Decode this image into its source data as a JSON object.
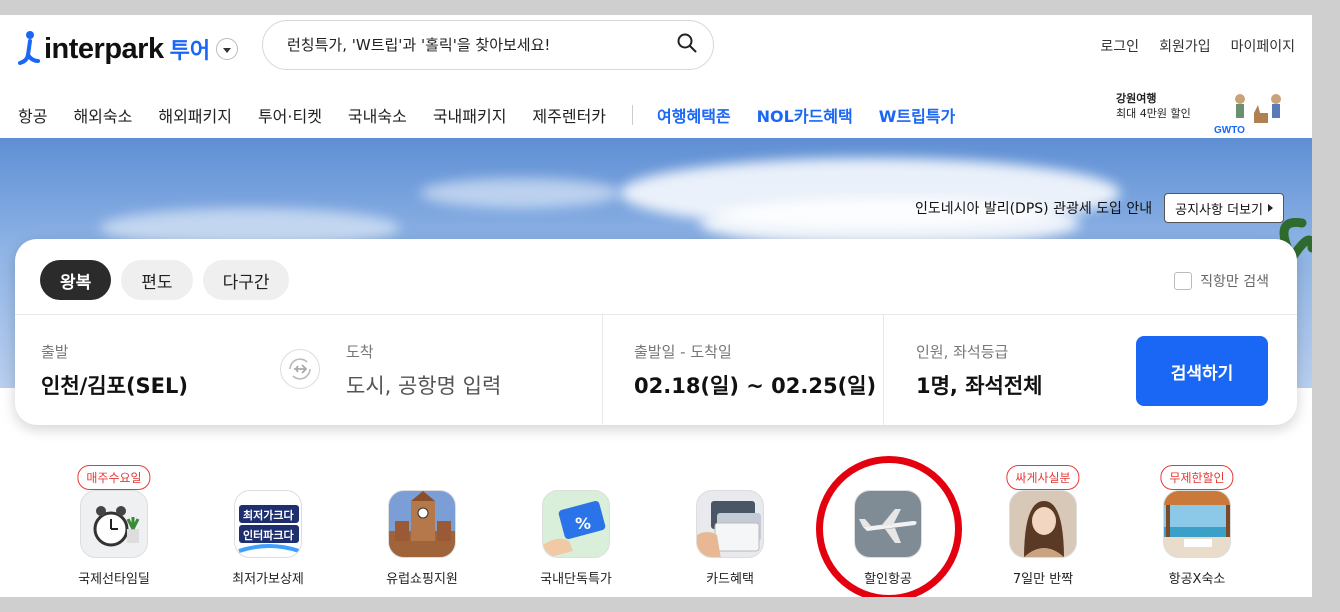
{
  "header": {
    "logo_text": "interpark",
    "logo_sub": "투어",
    "search_placeholder": "런칭특가, 'W트립'과 '홀릭'을 찾아보세요!",
    "links": [
      "로그인",
      "회원가입",
      "마이페이지"
    ]
  },
  "gnb": {
    "items": [
      "항공",
      "해외숙소",
      "해외패키지",
      "투어·티켓",
      "국내숙소",
      "국내패키지",
      "제주렌터카"
    ],
    "highlights": [
      "여행혜택존",
      "NOL카드혜택",
      "W트립특가"
    ]
  },
  "promo": {
    "line1": "강원여행",
    "line2": "최대 4만원 할인",
    "logo": "GWTO"
  },
  "notice": {
    "text": "인도네시아 발리(DPS) 관광세 도입 안내",
    "button": "공지사항 더보기"
  },
  "search_form": {
    "trip_types": [
      "왕복",
      "편도",
      "다구간"
    ],
    "active_trip": "왕복",
    "direct_label": "직항만 검색",
    "departure": {
      "label": "출발",
      "value": "인천/김포(SEL)"
    },
    "arrival": {
      "label": "도착",
      "placeholder": "도시, 공항명 입력"
    },
    "dates": {
      "label": "출발일 - 도착일",
      "value": "02.18(일) ~ 02.25(일)"
    },
    "passengers": {
      "label": "인원, 좌석등급",
      "value": "1명, 좌석전체"
    },
    "submit": "검색하기"
  },
  "shortcuts": [
    {
      "label": "국제선타임딜",
      "badge": "매주수요일",
      "icon": "alarm-clock-icon"
    },
    {
      "label": "최저가보상제",
      "badge": "",
      "icon": "lowest-price-icon"
    },
    {
      "label": "유럽쇼핑지원",
      "badge": "",
      "icon": "europe-building-icon"
    },
    {
      "label": "국내단독특가",
      "badge": "",
      "icon": "discount-ticket-icon"
    },
    {
      "label": "카드혜택",
      "badge": "",
      "icon": "credit-card-icon"
    },
    {
      "label": "할인항공",
      "badge": "",
      "icon": "airplane-icon"
    },
    {
      "label": "7일만 반짝",
      "badge": "싸게사실분",
      "icon": "person-photo-icon"
    },
    {
      "label": "항공X숙소",
      "badge": "무제한할인",
      "icon": "resort-icon"
    }
  ],
  "shortcut_thumb_text": {
    "lowest": "최저가크다",
    "lowest2": "인터파크다"
  },
  "colors": {
    "brand": "#1a67f5",
    "badge": "#e53935",
    "highlight_ring": "#e3000f"
  }
}
